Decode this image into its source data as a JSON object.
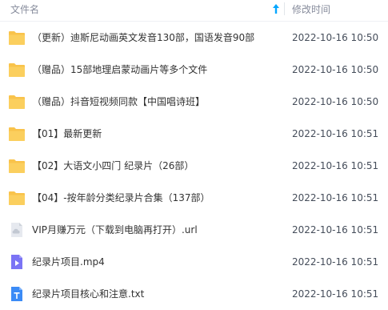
{
  "header": {
    "name_label": "文件名",
    "time_label": "修改时间",
    "sort_icon": "sort-ascending-arrow-icon"
  },
  "colors": {
    "folder": "#f9c34b",
    "accent": "#06a7ff",
    "video": "#7b74f5",
    "text_file": "#3b8bf6",
    "url_file": "#c9ced8"
  },
  "files": [
    {
      "name": "（更新）迪斯尼动画英文发音130部，国语发音90部",
      "time": "2022-10-16 10:50",
      "type": "folder"
    },
    {
      "name": "（赠品）15部地理启蒙动画片等多个文件",
      "time": "2022-10-16 10:50",
      "type": "folder"
    },
    {
      "name": "（赠品）抖音短视频同款【中国唱诗班】",
      "time": "2022-10-16 10:50",
      "type": "folder"
    },
    {
      "name": "【01】最新更新",
      "time": "2022-10-16 10:51",
      "type": "folder"
    },
    {
      "name": "【02】大语文小四门 纪录片（26部）",
      "time": "2022-10-16 10:51",
      "type": "folder"
    },
    {
      "name": "【04】-按年龄分类纪录片合集（137部）",
      "time": "2022-10-16 10:51",
      "type": "folder"
    },
    {
      "name": "VIP月赚万元（下载到电脑再打开）.url",
      "time": "2022-10-16 10:51",
      "type": "url"
    },
    {
      "name": "纪录片项目.mp4",
      "time": "2022-10-16 10:51",
      "type": "video"
    },
    {
      "name": "纪录片项目核心和注意.txt",
      "time": "2022-10-16 10:51",
      "type": "text"
    }
  ]
}
